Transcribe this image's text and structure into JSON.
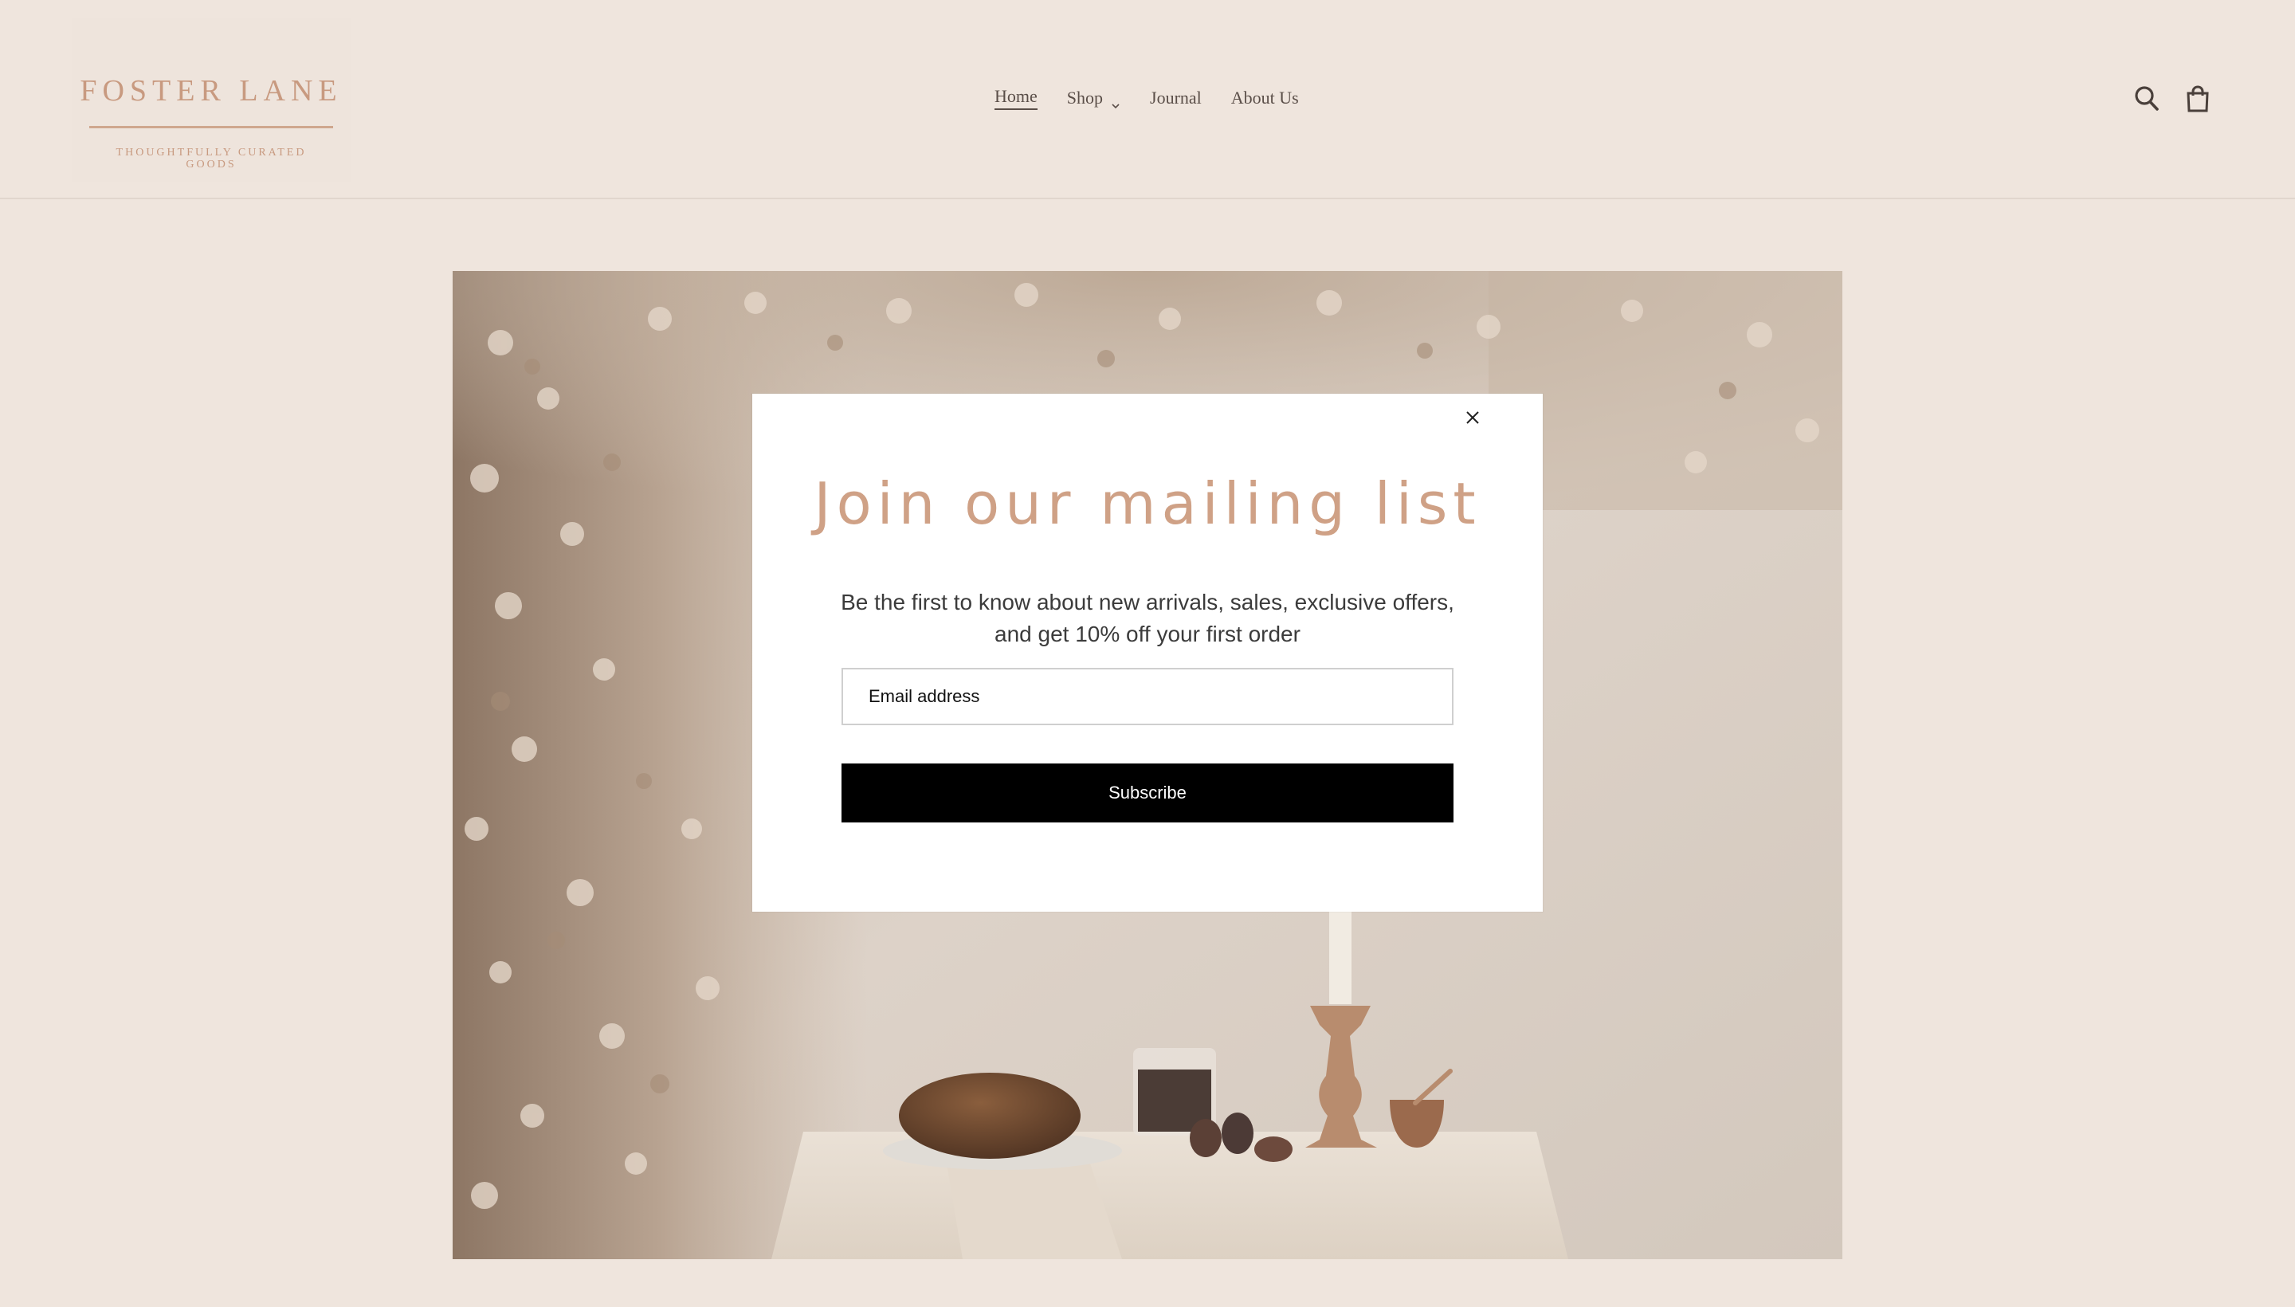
{
  "header": {
    "logo": {
      "title": "FOSTER LANE",
      "tagline": "THOUGHTFULLY CURATED GOODS"
    },
    "nav": [
      {
        "label": "Home",
        "active": true
      },
      {
        "label": "Shop",
        "has_dropdown": true
      },
      {
        "label": "Journal"
      },
      {
        "label": "About Us"
      }
    ],
    "icons": [
      "search-icon",
      "cart-icon"
    ]
  },
  "hero": {
    "image": "still life of dried lunaria branches, bread loaf, glass, figs and candlestick on linen table"
  },
  "popup": {
    "title": "Join our mailing list",
    "text": "Be the first to know about new arrivals, sales, exclusive offers, and get 10% off your first order",
    "email_placeholder": "Email address",
    "subscribe_label": "Subscribe",
    "close_icon": "close-icon"
  },
  "colors": {
    "background": "#efe5dd",
    "accent": "#cfa186",
    "button": "#000000"
  }
}
